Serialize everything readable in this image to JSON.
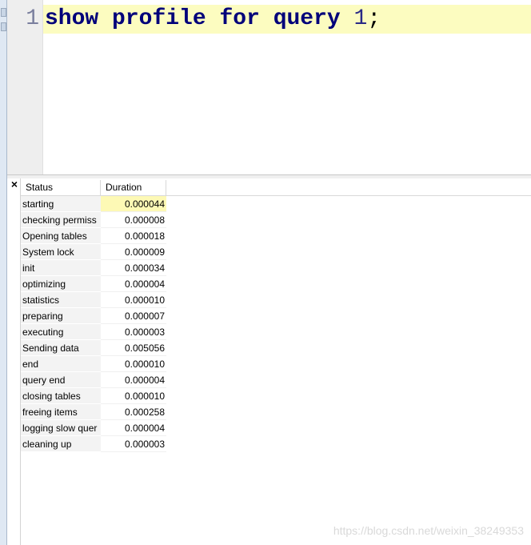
{
  "editor": {
    "line_number": "1",
    "code_tokens": [
      {
        "text": "show",
        "kind": "kw"
      },
      {
        "text": " ",
        "kind": "punct"
      },
      {
        "text": "profile",
        "kind": "kw"
      },
      {
        "text": " ",
        "kind": "punct"
      },
      {
        "text": "for",
        "kind": "kw"
      },
      {
        "text": " ",
        "kind": "punct"
      },
      {
        "text": "query",
        "kind": "kw"
      },
      {
        "text": " ",
        "kind": "punct"
      },
      {
        "text": "1",
        "kind": "num"
      },
      {
        "text": ";",
        "kind": "punct"
      }
    ]
  },
  "results": {
    "close_label": "×",
    "columns": [
      "Status",
      "Duration"
    ],
    "selected_row": 0,
    "rows": [
      {
        "status": "starting",
        "duration": "0.000044"
      },
      {
        "status": "checking permiss",
        "duration": "0.000008"
      },
      {
        "status": "Opening tables",
        "duration": "0.000018"
      },
      {
        "status": "System lock",
        "duration": "0.000009"
      },
      {
        "status": "init",
        "duration": "0.000034"
      },
      {
        "status": "optimizing",
        "duration": "0.000004"
      },
      {
        "status": "statistics",
        "duration": "0.000010"
      },
      {
        "status": "preparing",
        "duration": "0.000007"
      },
      {
        "status": "executing",
        "duration": "0.000003"
      },
      {
        "status": "Sending data",
        "duration": "0.005056"
      },
      {
        "status": "end",
        "duration": "0.000010"
      },
      {
        "status": "query end",
        "duration": "0.000004"
      },
      {
        "status": "closing tables",
        "duration": "0.000010"
      },
      {
        "status": "freeing items",
        "duration": "0.000258"
      },
      {
        "status": "logging slow quer",
        "duration": "0.000004"
      },
      {
        "status": "cleaning up",
        "duration": "0.000003"
      }
    ]
  },
  "watermark": "https://blog.csdn.net/weixin_38249353",
  "colors": {
    "keyword": "#00007a",
    "current_line": "#fcfcc0",
    "selected_cell": "#fdf9b5"
  }
}
